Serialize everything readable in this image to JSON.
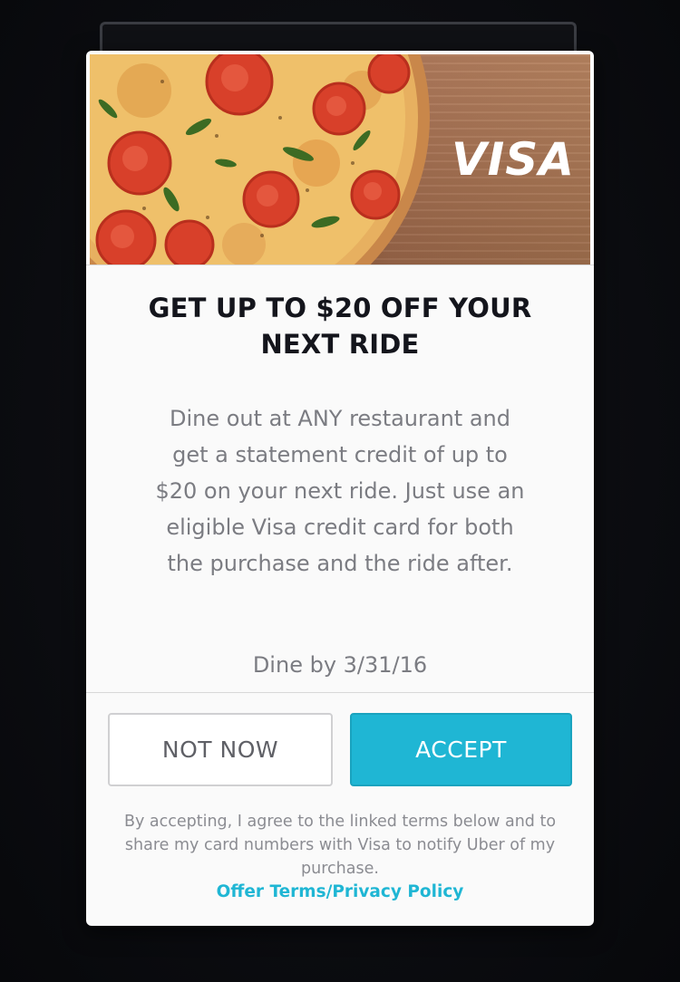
{
  "offer": {
    "brand": "VISA",
    "title": "GET UP TO $20 OFF YOUR NEXT RIDE",
    "body": "Dine out at ANY restaurant and get a statement credit of up to $20 on your next ride. Just use an eligible Visa credit card for both the purchase and the ride after.",
    "deadline": "Dine by 3/31/16",
    "colors": {
      "accent": "#1fb6d4",
      "title": "#14151c",
      "body_text": "#7b7c82",
      "overlay": "#0c0d11"
    }
  },
  "actions": {
    "dismiss_label": "NOT NOW",
    "accept_label": "ACCEPT"
  },
  "legal": {
    "disclaimer": "By accepting, I agree to the linked terms below and to share my card numbers with Visa to notify Uber of my purchase.",
    "link_label": "Offer Terms/Privacy Policy"
  }
}
